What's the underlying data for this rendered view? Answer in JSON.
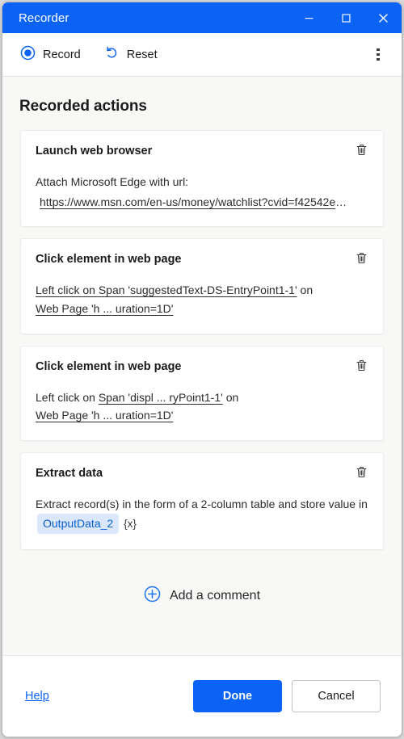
{
  "window": {
    "title": "Recorder",
    "controls": {
      "minimize": "minimize-icon",
      "maximize": "maximize-icon",
      "close": "close-icon"
    },
    "accent_color": "#0B63F6"
  },
  "toolbar": {
    "record_label": "Record",
    "record_icon": "record-circle-icon",
    "reset_label": "Reset",
    "reset_icon": "undo-arrow-icon",
    "overflow_icon": "more-vertical-icon"
  },
  "main": {
    "section_title": "Recorded actions",
    "cards": [
      {
        "title": "Launch web browser",
        "delete_icon": "trash-icon",
        "body_prefix": "Attach Microsoft Edge with url:",
        "url": "https://www.msn.com/en-us/money/watchlist?cvid=f42542e",
        "url_ellipsis": "…"
      },
      {
        "title": "Click element in web page",
        "delete_icon": "trash-icon",
        "line1_prefix": "Left click on ",
        "line1_target": "Span 'suggestedText-DS-EntryPoint1-1'",
        "line1_suffix": " on",
        "line2_target": "Web Page 'h ... uration=1D'"
      },
      {
        "title": "Click element in web page",
        "delete_icon": "trash-icon",
        "line1_prefix": "Left click on ",
        "line1_target": "Span 'displ ... ryPoint1-1'",
        "line1_suffix": " on",
        "line2_target": "Web Page 'h ... uration=1D'"
      },
      {
        "title": "Extract data",
        "delete_icon": "trash-icon",
        "body_prefix": "Extract record(s) in the form of a 2-column table and store value in",
        "variable_chip": "OutputData_2",
        "variable_suffix": "{x}",
        "chip_bg": "#dbe8fb",
        "chip_fg": "#0c5fd1"
      }
    ],
    "add_comment_label": "Add a comment",
    "add_comment_icon": "plus-circle-icon"
  },
  "footer": {
    "help_label": "Help",
    "done_label": "Done",
    "cancel_label": "Cancel"
  }
}
